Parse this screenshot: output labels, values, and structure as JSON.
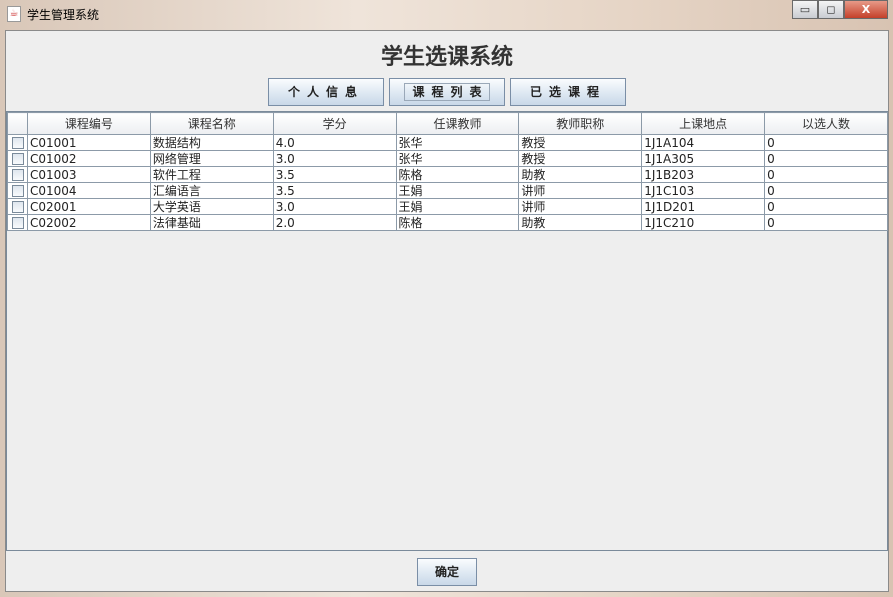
{
  "window": {
    "title": "学生管理系统",
    "minimize": "▭",
    "maximize": "◻",
    "close": "X"
  },
  "heading": "学生选课系统",
  "tabs": [
    {
      "label": "个人信息"
    },
    {
      "label": "课程列表"
    },
    {
      "label": "已选课程"
    }
  ],
  "table": {
    "columns": [
      "课程编号",
      "课程名称",
      "学分",
      "任课教师",
      "教师职称",
      "上课地点",
      "以选人数"
    ],
    "rows": [
      [
        "C01001",
        "数据结构",
        "4.0",
        "张华",
        "教授",
        "1J1A104",
        "0"
      ],
      [
        "C01002",
        "网络管理",
        "3.0",
        "张华",
        "教授",
        "1J1A305",
        "0"
      ],
      [
        "C01003",
        "软件工程",
        "3.5",
        "陈格",
        "助教",
        "1J1B203",
        "0"
      ],
      [
        "C01004",
        "汇编语言",
        "3.5",
        "王娟",
        "讲师",
        "1J1C103",
        "0"
      ],
      [
        "C02001",
        "大学英语",
        "3.0",
        "王娟",
        "讲师",
        "1J1D201",
        "0"
      ],
      [
        "C02002",
        "法律基础",
        "2.0",
        "陈格",
        "助教",
        "1J1C210",
        "0"
      ]
    ]
  },
  "confirm_label": "确定"
}
